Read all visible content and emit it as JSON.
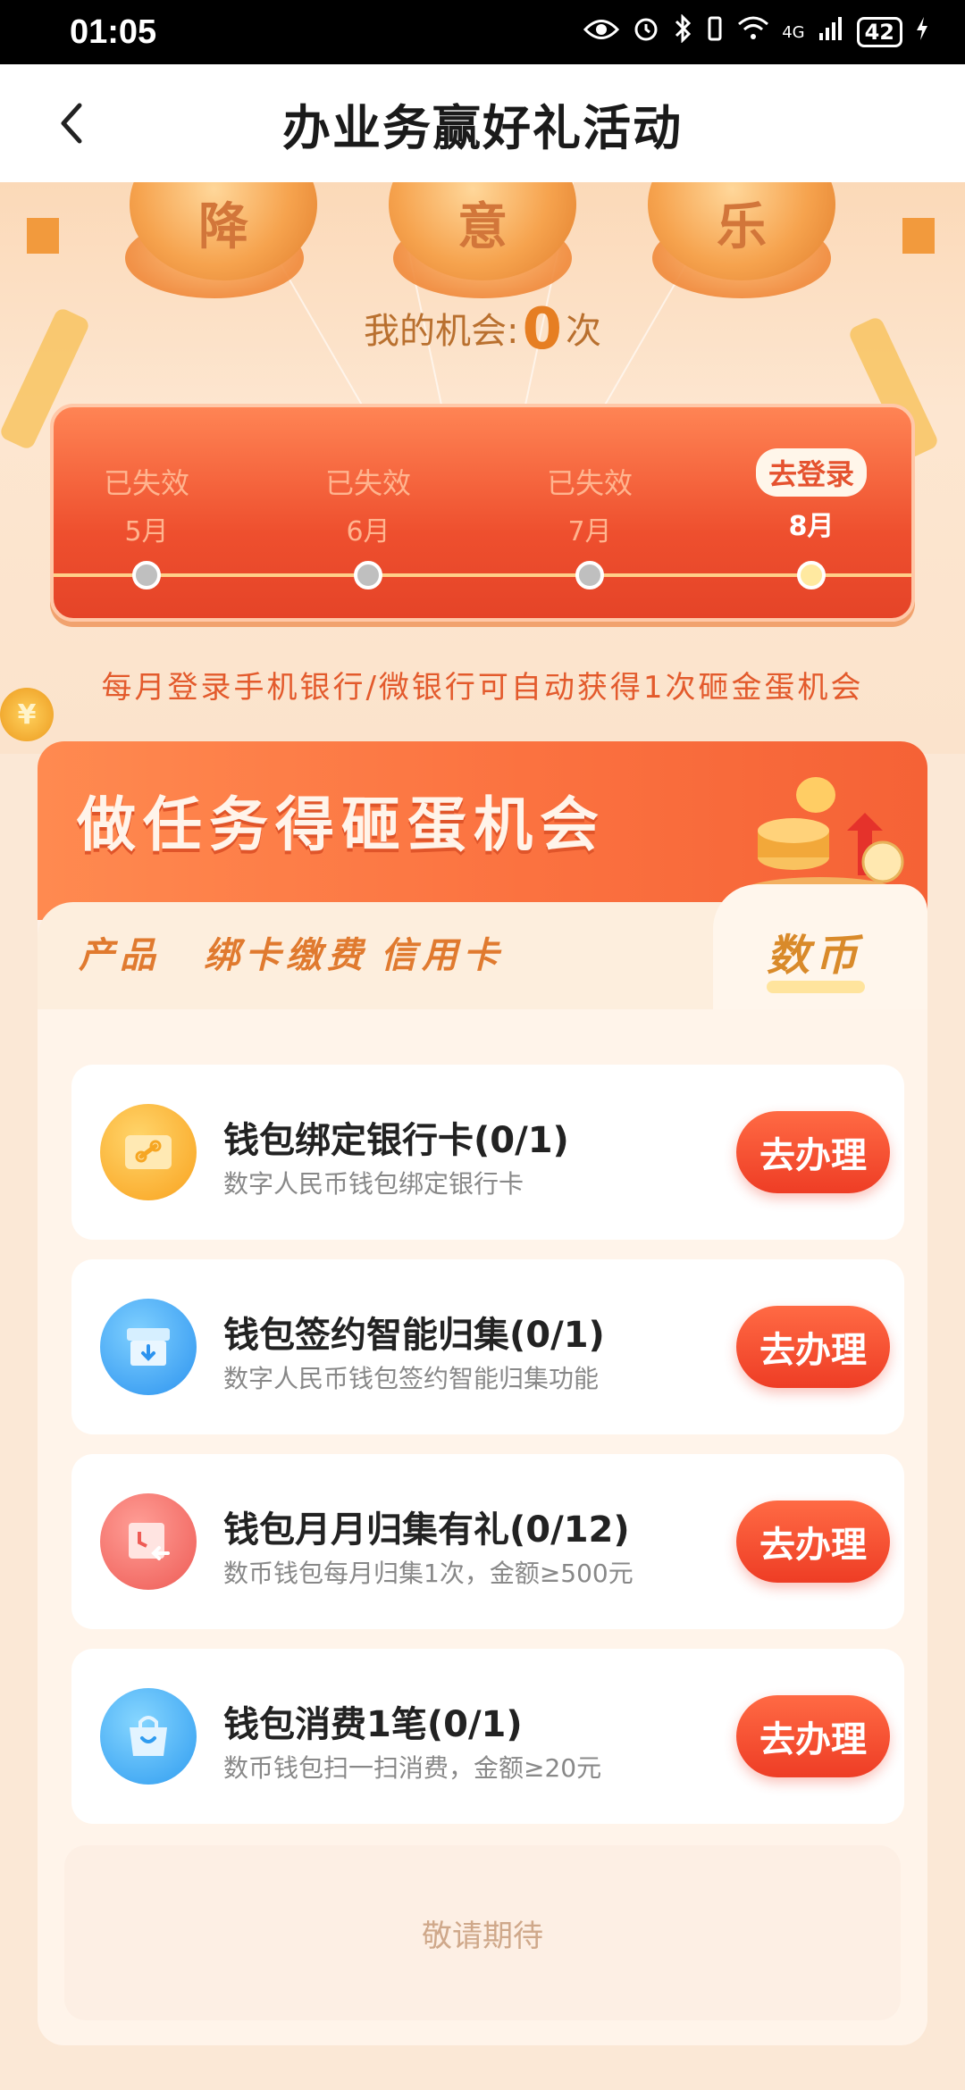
{
  "status_bar": {
    "time": "01:05",
    "network": "4G",
    "battery": "42"
  },
  "header": {
    "title": "办业务赢好礼活动"
  },
  "hero": {
    "egg_chars": [
      "降",
      "意",
      "乐"
    ],
    "chances_label": "我的机会:",
    "chances_value": "0",
    "chances_unit": "次"
  },
  "timeline": {
    "months": [
      {
        "status": "已失效",
        "label": "5月"
      },
      {
        "status": "已失效",
        "label": "6月"
      },
      {
        "status": "已失效",
        "label": "7月"
      },
      {
        "status": "去登录",
        "label": "8月"
      }
    ],
    "note": "每月登录手机银行/微银行可自动获得1次砸金蛋机会"
  },
  "coin_symbol": "¥",
  "tasks_panel": {
    "banner_title": "做任务得砸蛋机会",
    "tabs": [
      {
        "label": "产品"
      },
      {
        "label": "绑卡缴费"
      },
      {
        "label": "信用卡"
      },
      {
        "label": "数币"
      }
    ],
    "active_tab": "数币",
    "items": [
      {
        "title": "钱包绑定银行卡(0/1)",
        "desc": "数字人民币钱包绑定银行卡",
        "button": "去办理",
        "icon": "card-link-icon",
        "color": "#fbb130"
      },
      {
        "title": "钱包签约智能归集(0/1)",
        "desc": "数字人民币钱包签约智能归集功能",
        "button": "去办理",
        "icon": "inbox-download-icon",
        "color": "#3fa9f5"
      },
      {
        "title": "钱包月月归集有礼(0/12)",
        "desc": "数币钱包每月归集1次，金额≥500元",
        "button": "去办理",
        "icon": "calendar-return-icon",
        "color": "#f26a62"
      },
      {
        "title": "钱包消费1笔(0/1)",
        "desc": "数币钱包扫一扫消费，金额≥20元",
        "button": "去办理",
        "icon": "shopping-bag-icon",
        "color": "#3fb1f5"
      }
    ],
    "coming_soon": "敬请期待"
  }
}
